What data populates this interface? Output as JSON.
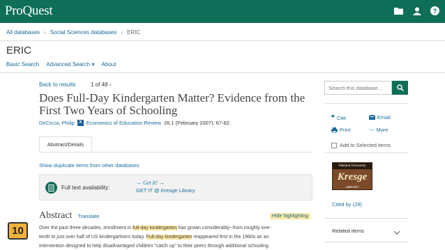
{
  "app": {
    "brand": "ProQuest"
  },
  "breadcrumb": {
    "items": [
      "All databases",
      "Social Sciences databases",
      "ERIC"
    ]
  },
  "database": {
    "title": "ERIC",
    "nav": [
      "Basic Search",
      "Advanced Search ▾",
      "About"
    ]
  },
  "record": {
    "back_label": "Back to results",
    "counter": "1 of 48 ›",
    "title": "Does Full-Day Kindergarten Matter? Evidence from the First Two Years of Schooling",
    "author": "DeCicca, Philip",
    "journal": "Economics of Education Review",
    "citation_rest": "26.1   (February 2007): 67-82.",
    "tab_label": "Abstract/Details",
    "duplicates_link": "Show duplicate items from other databases",
    "fulltext_label": "Full text availability:",
    "getit_logo": "→ Get It! →",
    "getit_link": "GET IT @ Kresge Library"
  },
  "abstract": {
    "heading": "Abstract",
    "translate": "Translate",
    "hide_highlighting": "Hide highlighting",
    "line1_a": "Over the past three decades, enrollment in ",
    "line1_hl": "full-day kindergarten",
    "line1_b": " has grown considerably--from roughly one-",
    "line2_a": "tenth to just over half of US kindergartners today. ",
    "line2_hl": "Full-day kindergarten",
    "line2_b": " reappeared first in the 1960s as an",
    "line3": "intervention designed to help disadvantaged children \"catch up\" to their peers through additional schooling."
  },
  "slide_number": "10",
  "sidebar": {
    "search_placeholder": "Search this database...",
    "tools": {
      "cite": "Cite",
      "email": "Email",
      "print": "Print",
      "more": "More"
    },
    "add_selected": "Add to Selected items",
    "library_logo": {
      "top": "Oakland University",
      "mid": "Kresge",
      "bottom": "LIBRARY"
    },
    "cited_by": "Cited by (29)",
    "related": "Related items"
  },
  "colors": {
    "brand_green": "#0e6e58",
    "link_blue": "#1a6a9a",
    "highlight": "#fbe8a0",
    "slide_badge": "#f2b33c"
  },
  "icons": [
    "folder-icon",
    "user-icon",
    "help-icon",
    "search-icon",
    "quote-icon",
    "email-icon",
    "print-icon",
    "more-icon",
    "document-icon",
    "chevron-down-icon"
  ]
}
